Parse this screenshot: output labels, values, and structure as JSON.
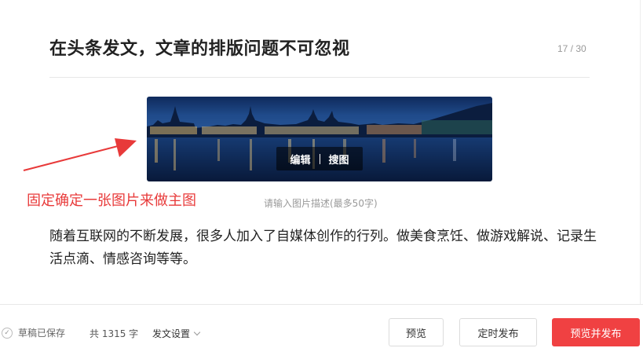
{
  "editor": {
    "title": "在头条发文，文章的排版问题不可忽视",
    "title_count": "17 / 30",
    "image_toolbar": {
      "edit": "编辑",
      "search": "搜图"
    },
    "caption_placeholder": "请输入图片描述(最多50字)",
    "annotation": "固定确定一张图片来做主图",
    "body": "随着互联网的不断发展，很多人加入了自媒体创作的行列。做美食烹饪、做游戏解说、记录生活点滴、情感咨询等等。"
  },
  "footer": {
    "saved_status": "草稿已保存",
    "word_count": "共 1315 字",
    "settings_label": "发文设置",
    "preview_label": "预览",
    "timed_publish_label": "定时发布",
    "preview_publish_label": "预览并发布"
  },
  "colors": {
    "accent": "#f04142",
    "annotation": "#e83a3a"
  }
}
